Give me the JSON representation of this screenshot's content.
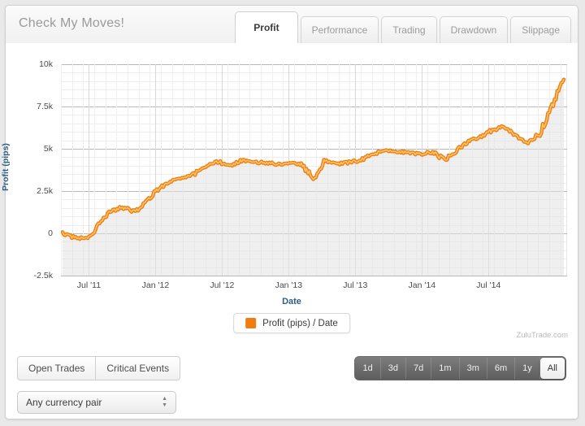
{
  "header": {
    "title": "Check My Moves!",
    "tabs": [
      {
        "label": "Profit",
        "active": true
      },
      {
        "label": "Performance",
        "active": false
      },
      {
        "label": "Trading",
        "active": false
      },
      {
        "label": "Drawdown",
        "active": false
      },
      {
        "label": "Slippage",
        "active": false
      }
    ]
  },
  "legend": {
    "label": "Profit (pips)  /  Date",
    "swatch_color": "#f07d12"
  },
  "watermark": "ZuluTrade.com",
  "footer": {
    "buttons": [
      {
        "label": "Open Trades"
      },
      {
        "label": "Critical Events"
      }
    ],
    "currency_select": {
      "value": "Any currency pair"
    },
    "ranges": [
      {
        "label": "1d",
        "active": false
      },
      {
        "label": "3d",
        "active": false
      },
      {
        "label": "7d",
        "active": false
      },
      {
        "label": "1m",
        "active": false
      },
      {
        "label": "3m",
        "active": false
      },
      {
        "label": "6m",
        "active": false
      },
      {
        "label": "1y",
        "active": false
      },
      {
        "label": "All",
        "active": true
      }
    ]
  },
  "chart_data": {
    "type": "line",
    "title": "",
    "xlabel": "Date",
    "ylabel": "Profit (pips)",
    "ylim": [
      -2500,
      10000
    ],
    "yticks": [
      10000,
      7500,
      5000,
      2500,
      0,
      -2500
    ],
    "ytick_labels": [
      "10k",
      "7.5k",
      "5k",
      "2.5k",
      "0",
      "-2.5k"
    ],
    "xticks": [
      "Jul '11",
      "Jan '12",
      "Jul '12",
      "Jan '13",
      "Jul '13",
      "Jan '14",
      "Jul '14"
    ],
    "xlim": [
      "2011-05",
      "2014-11"
    ],
    "grid": true,
    "legend_position": "bottom-center",
    "line_color": "#f07d12",
    "line_highlight_color": "#fcc56a",
    "fill_color": "#e2e2e2",
    "series": [
      {
        "name": "Profit (pips) / Date",
        "x": [
          "2011-05",
          "2011-06",
          "2011-07",
          "2011-08",
          "2011-09",
          "2011-10",
          "2011-11",
          "2011-12",
          "2012-01",
          "2012-02",
          "2012-03",
          "2012-04",
          "2012-05",
          "2012-06",
          "2012-07",
          "2012-08",
          "2012-09",
          "2012-10",
          "2012-11",
          "2012-12",
          "2013-01",
          "2013-02",
          "2013-03",
          "2013-04",
          "2013-05",
          "2013-06",
          "2013-07",
          "2013-08",
          "2013-09",
          "2013-10",
          "2013-11",
          "2013-12",
          "2014-01",
          "2014-02",
          "2014-03",
          "2014-04",
          "2014-05",
          "2014-06",
          "2014-07",
          "2014-08",
          "2014-09",
          "2014-10",
          "2014-11"
        ],
        "values": [
          0,
          -250,
          -300,
          450,
          1250,
          1550,
          1250,
          1900,
          2600,
          3050,
          3300,
          3500,
          3900,
          4250,
          4000,
          4300,
          4250,
          4150,
          4100,
          4200,
          4100,
          3250,
          4300,
          4100,
          4200,
          4300,
          4700,
          4900,
          4850,
          4750,
          4700,
          4800,
          4350,
          4900,
          5400,
          5700,
          6100,
          6350,
          5800,
          5350,
          5900,
          7500,
          9100
        ]
      }
    ],
    "approx_peak": 9100,
    "approx_start": 0
  }
}
